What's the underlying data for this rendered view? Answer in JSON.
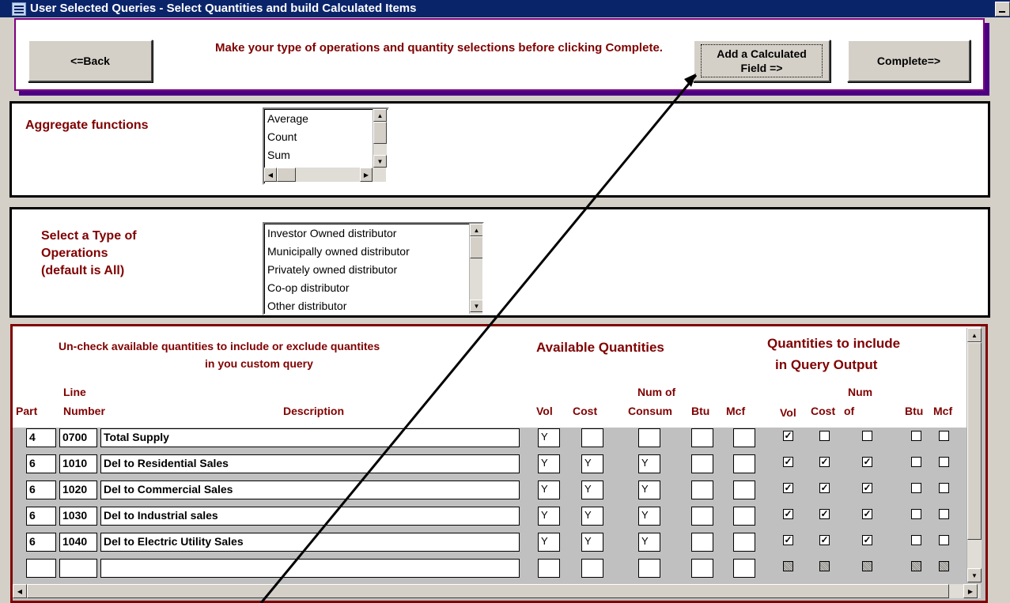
{
  "window": {
    "title": "User Selected Queries - Select Quantities and build Calculated Items"
  },
  "toolbar": {
    "back_label": "<=Back",
    "instruction": "Make your type of operations and quantity selections before clicking Complete.",
    "add_calc_label": "Add a Calculated Field =>",
    "complete_label": "Complete=>"
  },
  "aggregate": {
    "label": "Aggregate functions",
    "options": [
      "Average",
      "Count",
      "Sum"
    ]
  },
  "operations": {
    "label_lines": [
      "Select a Type of",
      "Operations",
      "(default is All)"
    ],
    "options": [
      "Investor Owned distributor",
      "Municipally owned distributor",
      "Privately owned distributor",
      "Co-op distributor",
      "Other distributor"
    ]
  },
  "quantities": {
    "instruction_line1": "Un-check available quantities to include or exclude quantites",
    "instruction_line2": "in you custom query",
    "available_title": "Available Quantities",
    "include_title_line1": "Quantities to include",
    "include_title_line2": "in Query Output",
    "columns": {
      "part": "Part",
      "line_top": "Line",
      "line_bottom": "Number",
      "description": "Description",
      "vol": "Vol",
      "cost": "Cost",
      "num_top": "Num of",
      "num_bottom": "Consum",
      "btu": "Btu",
      "mcf": "Mcf",
      "out_vol": "Vol",
      "out_cost": "Cost",
      "out_num_top": "Num",
      "out_num_bottom": "of",
      "out_btu": "Btu",
      "out_mcf": "Mcf"
    },
    "rows": [
      {
        "part": "4",
        "line": "0700",
        "desc": "Total Supply",
        "vol": "Y",
        "cost": "",
        "num": "",
        "btu": "",
        "mcf": "",
        "out": [
          true,
          false,
          false,
          false,
          false
        ]
      },
      {
        "part": "6",
        "line": "1010",
        "desc": "Del to Residential Sales",
        "vol": "Y",
        "cost": "Y",
        "num": "Y",
        "btu": "",
        "mcf": "",
        "out": [
          true,
          true,
          true,
          false,
          false
        ]
      },
      {
        "part": "6",
        "line": "1020",
        "desc": "Del to Commercial Sales",
        "vol": "Y",
        "cost": "Y",
        "num": "Y",
        "btu": "",
        "mcf": "",
        "out": [
          true,
          true,
          true,
          false,
          false
        ]
      },
      {
        "part": "6",
        "line": "1030",
        "desc": "Del to Industrial sales",
        "vol": "Y",
        "cost": "Y",
        "num": "Y",
        "btu": "",
        "mcf": "",
        "out": [
          true,
          true,
          true,
          false,
          false
        ]
      },
      {
        "part": "6",
        "line": "1040",
        "desc": "Del to Electric Utility Sales",
        "vol": "Y",
        "cost": "Y",
        "num": "Y",
        "btu": "",
        "mcf": "",
        "out": [
          true,
          true,
          true,
          false,
          false
        ]
      },
      {
        "part": "",
        "line": "",
        "desc": "",
        "vol": "",
        "cost": "",
        "num": "",
        "btu": "",
        "mcf": "",
        "out": [
          null,
          null,
          null,
          null,
          null
        ]
      }
    ]
  }
}
